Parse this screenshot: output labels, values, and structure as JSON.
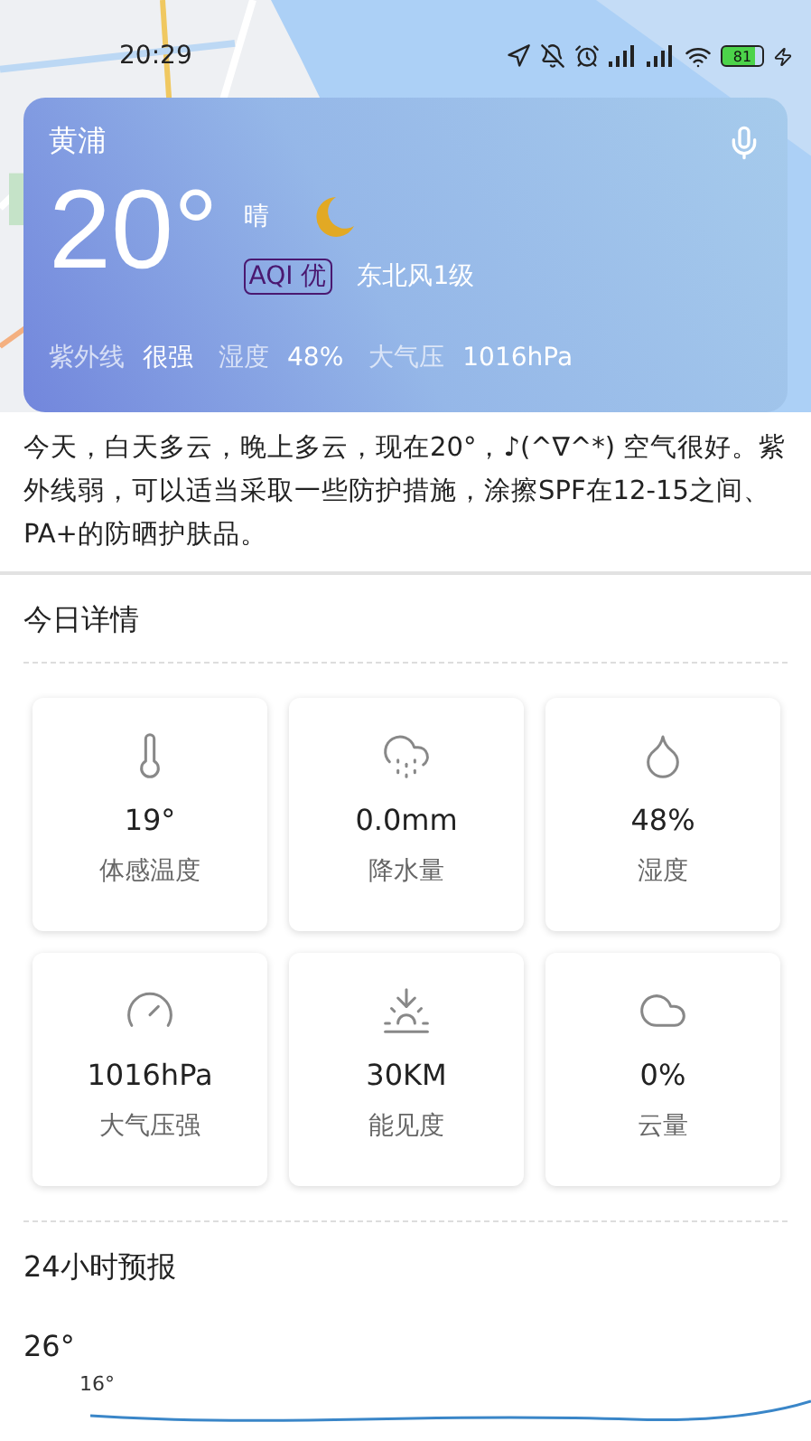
{
  "status_bar": {
    "time": "20:29",
    "battery": "81"
  },
  "weather_card": {
    "city": "黄浦",
    "temperature": "20°",
    "condition": "晴",
    "aqi": "AQI 优",
    "wind": "东北风1级",
    "stats": [
      {
        "label": "紫外线",
        "value": "很强"
      },
      {
        "label": "湿度",
        "value": "48%"
      },
      {
        "label": "大气压",
        "value": "1016hPa"
      }
    ]
  },
  "summary": "今天，白天多云，晚上多云，现在20°，♪(^∇^*) 空气很好。紫外线弱，可以适当采取一些防护措施，涂擦SPF在12-15之间、PA+的防晒护肤品。",
  "today_details": {
    "title": "今日详情",
    "items": [
      {
        "kind": "thermometer",
        "value": "19°",
        "label": "体感温度"
      },
      {
        "kind": "rain",
        "value": "0.0mm",
        "label": "降水量"
      },
      {
        "kind": "drop",
        "value": "48%",
        "label": "湿度"
      },
      {
        "kind": "gauge",
        "value": "1016hPa",
        "label": "大气压强"
      },
      {
        "kind": "sunrise",
        "value": "30KM",
        "label": "能见度"
      },
      {
        "kind": "cloud",
        "value": "0%",
        "label": "云量"
      }
    ]
  },
  "forecast_24h": {
    "title": "24小时预报",
    "high": "26°",
    "low": "16°"
  }
}
